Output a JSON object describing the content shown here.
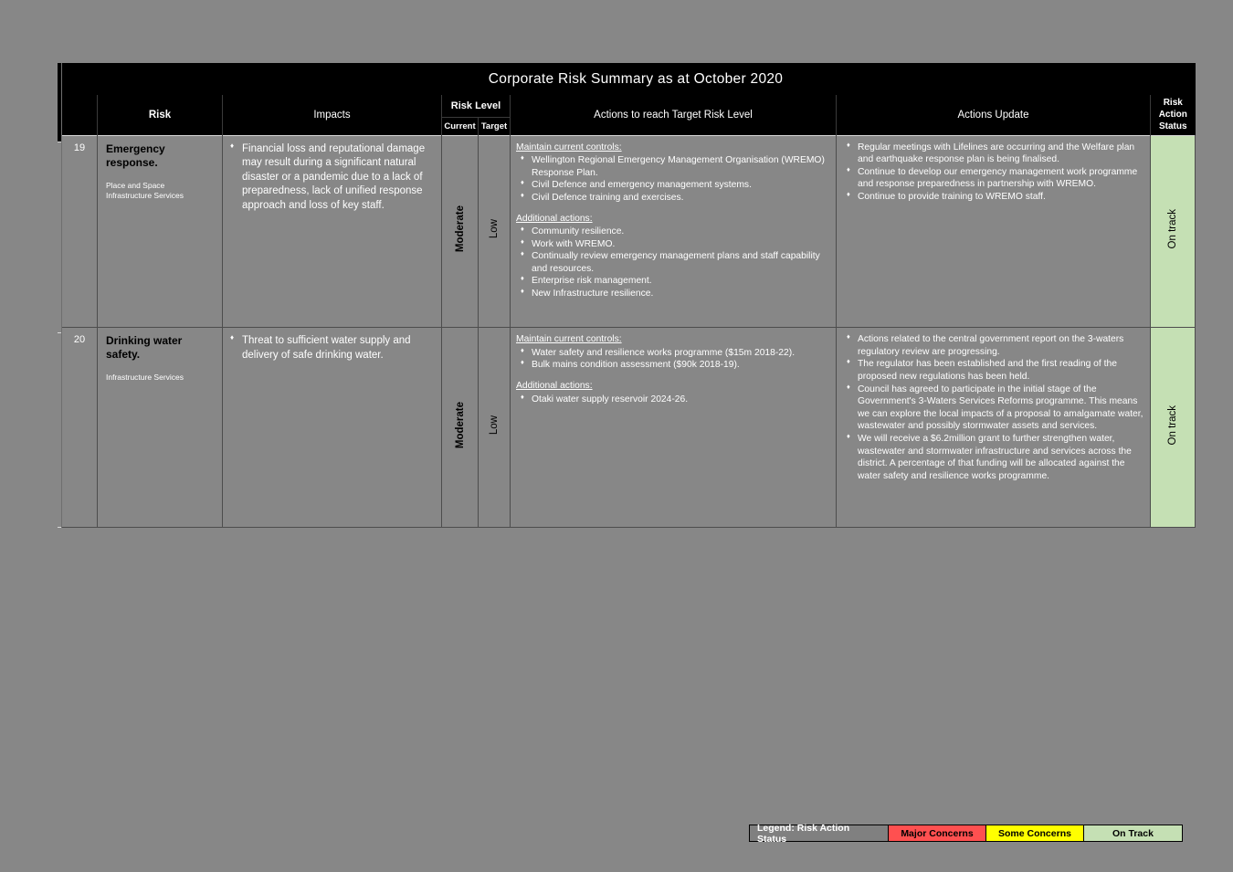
{
  "document": {
    "title": "Corporate Risk Summary as at October 2020"
  },
  "table": {
    "headers": {
      "number": "",
      "risk": "Risk",
      "impacts": "Impacts",
      "risk_level": "Risk Level",
      "current": "Current",
      "target": "Target",
      "actions": "Actions to reach Target Risk Level",
      "actions_update": "Actions Update",
      "risk_action_status": "Risk Action Status"
    },
    "rows": [
      {
        "number": "19",
        "risk_title": "Emergency response.",
        "risk_owner_line1": "Place and Space",
        "risk_owner_line2": "Infrastructure Services",
        "impacts": [
          "Financial loss and reputational damage may result during a significant natural disaster or a pandemic due to a lack of preparedness, lack of unified response approach and loss of key staff."
        ],
        "level_current": "Moderate",
        "level_target": "Low",
        "actions_sections": [
          {
            "heading": "Maintain current controls:",
            "items": [
              "Wellington Regional Emergency Management Organisation (WREMO) Response Plan.",
              "Civil Defence and emergency management systems.",
              "Civil Defence training and exercises."
            ]
          },
          {
            "heading": "Additional actions:",
            "items": [
              "Community resilience.",
              "Work with WREMO.",
              "Continually review emergency management plans and staff capability and resources.",
              "Enterprise risk management.",
              "New Infrastructure resilience."
            ]
          }
        ],
        "updates": [
          "Regular meetings with Lifelines are occurring and the Welfare plan and earthquake response plan is being finalised.",
          "Continue to develop our emergency management work programme and response preparedness in partnership with WREMO.",
          "Continue to provide training to WREMO staff."
        ],
        "status": "On track"
      },
      {
        "number": "20",
        "risk_title": "Drinking water safety.",
        "risk_owner_line1": "Infrastructure Services",
        "risk_owner_line2": "",
        "impacts": [
          "Threat to sufficient water supply and delivery of safe drinking water."
        ],
        "level_current": "Moderate",
        "level_target": "Low",
        "actions_sections": [
          {
            "heading": "Maintain current controls:",
            "items": [
              "Water safety and resilience works programme ($15m 2018-22).",
              "Bulk mains condition assessment ($90k 2018-19)."
            ]
          },
          {
            "heading": "Additional actions:",
            "items": [
              "Otaki water supply reservoir 2024-26."
            ]
          }
        ],
        "updates": [
          "Actions related to the central government report on the 3-waters regulatory review are progressing.",
          "The regulator has been established and the first reading of the proposed new regulations has been held.",
          "Council has agreed to participate in the initial stage of the Government's 3-Waters Services Reforms programme. This means we can explore the local impacts of a proposal to amalgamate water, wastewater and possibly stormwater assets and services.",
          "We will receive a $6.2million grant to further strengthen water, wastewater and stormwater infrastructure and services across the district. A percentage of that funding will be allocated against the water safety and resilience works programme."
        ],
        "status": "On track"
      }
    ]
  },
  "legend": {
    "label": "Legend: Risk Action Status",
    "items": [
      {
        "label": "Major Concerns",
        "color": "#FF5050"
      },
      {
        "label": "Some Concerns",
        "color": "#FFFF00"
      },
      {
        "label": "On Track",
        "color": "#C5E0B4"
      }
    ]
  },
  "colors": {
    "page_background": "#878787",
    "header_background": "#000000",
    "risk_moderate": "#FFC000",
    "risk_low": "#BFBFBF",
    "status_on_track": "#C5E0B4"
  }
}
